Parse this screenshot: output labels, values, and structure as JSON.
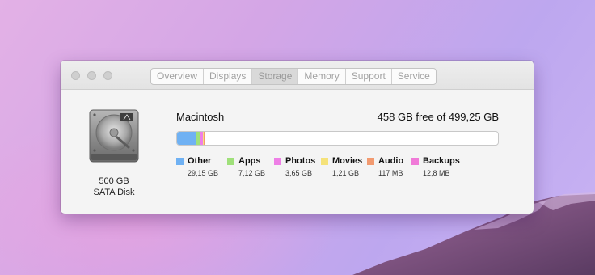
{
  "tabs": [
    "Overview",
    "Displays",
    "Storage",
    "Memory",
    "Support",
    "Service"
  ],
  "active_tab": "Storage",
  "disk": {
    "capacity": "500 GB",
    "type": "SATA Disk"
  },
  "volume": {
    "name": "Macintosh",
    "free_text": "458 GB free of 499,25 GB",
    "free_gb": 458,
    "total_gb": 499.25
  },
  "categories": [
    {
      "name": "Other",
      "size": "29,15 GB",
      "gb": 29.15,
      "color": "#6fb1f3"
    },
    {
      "name": "Apps",
      "size": "7,12 GB",
      "gb": 7.12,
      "color": "#9fe07a"
    },
    {
      "name": "Photos",
      "size": "3,65 GB",
      "gb": 3.65,
      "color": "#ee7fe6"
    },
    {
      "name": "Movies",
      "size": "1,21 GB",
      "gb": 1.21,
      "color": "#f5e27a"
    },
    {
      "name": "Audio",
      "size": "117 MB",
      "gb": 0.117,
      "color": "#f29a70"
    },
    {
      "name": "Backups",
      "size": "12,8 MB",
      "gb": 0.0128,
      "color": "#f07ad8"
    }
  ]
}
